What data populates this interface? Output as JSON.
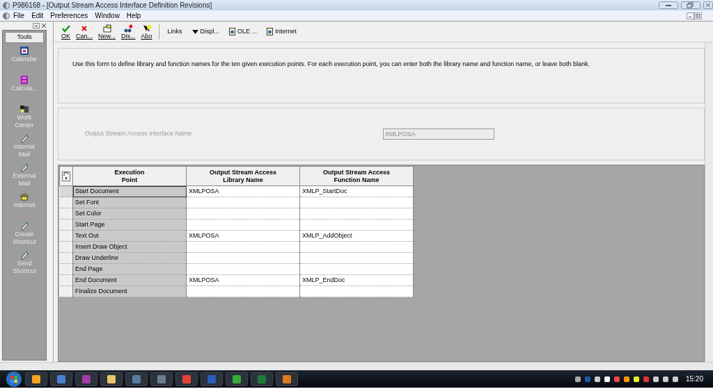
{
  "window": {
    "title": "P986168 - [Output Stream Access Interface Definition Revisions]"
  },
  "menu": [
    "File",
    "Edit",
    "Preferences",
    "Window",
    "Help"
  ],
  "toolbar": {
    "buttons": [
      {
        "label": "OK"
      },
      {
        "label": "Can..."
      },
      {
        "label": "New..."
      },
      {
        "label": "Dis..."
      },
      {
        "label": "Abo"
      }
    ],
    "links": [
      {
        "label": "Links",
        "kind": "plain"
      },
      {
        "label": "Displ...",
        "kind": "dropdown"
      },
      {
        "label": "OLE ...",
        "kind": "page"
      },
      {
        "label": "Internet",
        "kind": "page"
      }
    ]
  },
  "sidebar": {
    "title": "Tools",
    "items": [
      {
        "label": "Calendar"
      },
      {
        "label": "Calcula..."
      },
      {
        "label": "Work Center"
      },
      {
        "label": "Internal Mail"
      },
      {
        "label": "External Mail"
      },
      {
        "label": "Internet"
      },
      {
        "label": "Create Shortcut"
      },
      {
        "label": "Send Shortcut"
      }
    ]
  },
  "instructions": "Use this form to define library and function names for the ten given execution points.  For each execution point, you can enter both the library name and function name, or leave both blank.",
  "interface_field": {
    "label": "Output Stream Access Interface Name",
    "value": "XMLPOSA",
    "disabled": true
  },
  "table": {
    "columns": [
      "Execution Point",
      "Output Stream Access Library Name",
      "Output Stream Access Function Name"
    ],
    "rows": [
      {
        "execution_point": "Start Document",
        "library_name": "XMLPOSA",
        "function_name": "XMLP_StartDoc",
        "selected": true
      },
      {
        "execution_point": "Set Font",
        "library_name": "",
        "function_name": "",
        "selected": false
      },
      {
        "execution_point": "Set Color",
        "library_name": "",
        "function_name": "",
        "selected": false
      },
      {
        "execution_point": "Start Page",
        "library_name": "",
        "function_name": "",
        "selected": false
      },
      {
        "execution_point": "Text Out",
        "library_name": "XMLPOSA",
        "function_name": "XMLP_AddObject",
        "selected": false
      },
      {
        "execution_point": "Insert Draw Object",
        "library_name": "",
        "function_name": "",
        "selected": false
      },
      {
        "execution_point": "Draw Underline",
        "library_name": "",
        "function_name": "",
        "selected": false
      },
      {
        "execution_point": "End Page",
        "library_name": "",
        "function_name": "",
        "selected": false
      },
      {
        "execution_point": "End Document",
        "library_name": "XMLPOSA",
        "function_name": "XMLP_EndDoc",
        "selected": false
      },
      {
        "execution_point": "Finalize Document",
        "library_name": "",
        "function_name": "",
        "selected": false
      }
    ]
  },
  "taskbar": {
    "clock": "15:20"
  }
}
